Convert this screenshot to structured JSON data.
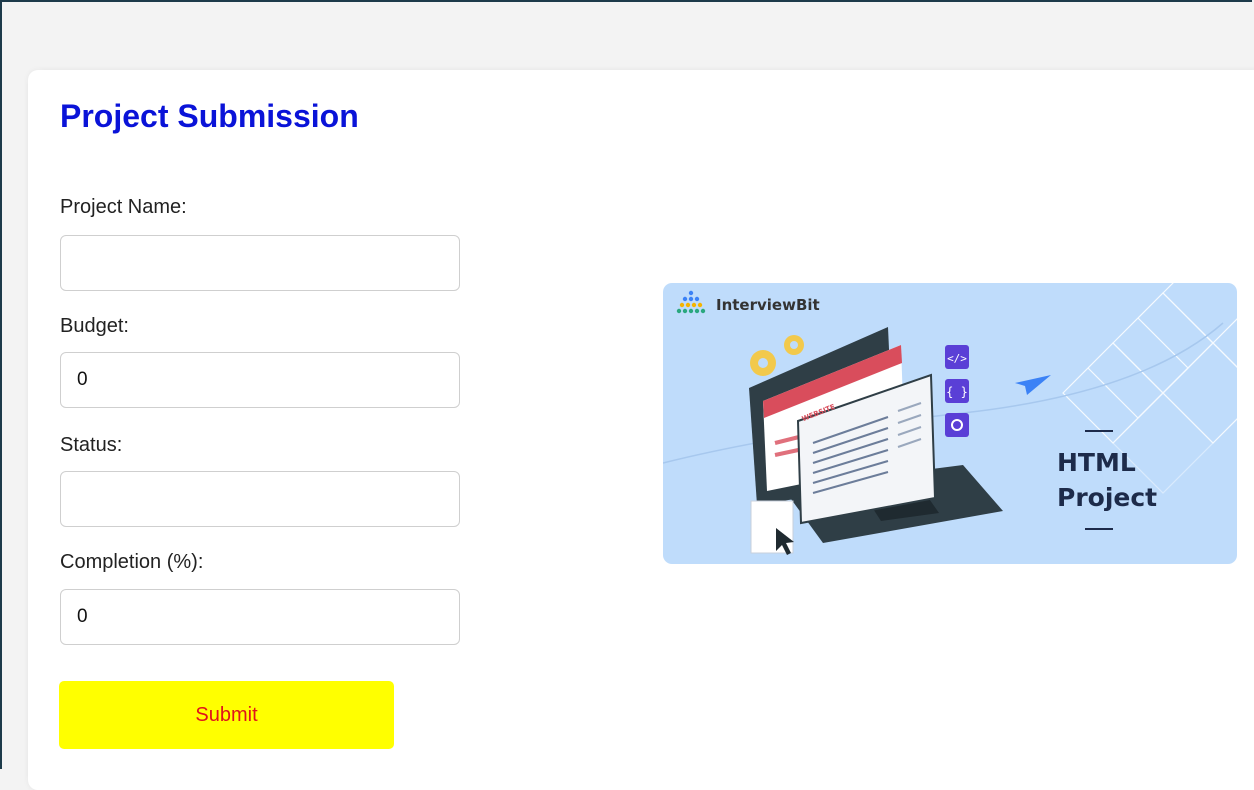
{
  "form": {
    "title": "Project Submission",
    "fields": [
      {
        "label": "Project Name:",
        "value": ""
      },
      {
        "label": "Budget:",
        "value": "0"
      },
      {
        "label": "Status:",
        "value": ""
      },
      {
        "label": "Completion (%):",
        "value": "0"
      }
    ],
    "submit_label": "Submit"
  },
  "banner": {
    "brand": "InterviewBit",
    "line1": "HTML",
    "line2": "Project",
    "screen_label": "WEBSITE",
    "colors": {
      "background": "#bfdcfb",
      "accent": "#1d2b4a"
    }
  },
  "colors": {
    "title": "#0a13d8",
    "submit_bg": "#ffff00",
    "submit_text": "#e0131b"
  }
}
